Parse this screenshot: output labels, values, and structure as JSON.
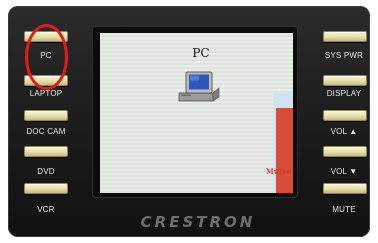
{
  "left_buttons": [
    {
      "label": "PC"
    },
    {
      "label": "LAPTOP"
    },
    {
      "label": "DOC CAM"
    },
    {
      "label": "DVD"
    },
    {
      "label": "VCR"
    }
  ],
  "right_buttons": [
    {
      "label": "SYS PWR"
    },
    {
      "label": "DISPLAY"
    },
    {
      "label": "VOL ▲"
    },
    {
      "label": "VOL ▼"
    },
    {
      "label": "MUTE"
    }
  ],
  "screen": {
    "title": "PC",
    "status": "Muted",
    "icon": "computer-monitor-icon"
  },
  "brand": "CRESTRON",
  "colors": {
    "button_face": "#ece3a8",
    "volume_bar": "#d74d37",
    "annotation": "#e41a1a"
  }
}
